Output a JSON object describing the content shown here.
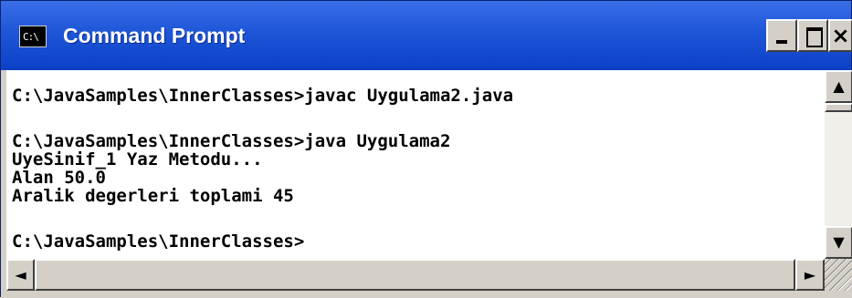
{
  "window": {
    "title": "Command Prompt",
    "icon_label": "C:\\",
    "icon": "console-icon",
    "controls": {
      "minimize": "minimize-icon",
      "maximize": "maximize-icon",
      "close": "×"
    }
  },
  "console": {
    "lines": [
      "",
      "C:\\JavaSamples\\InnerClasses>javac Uygulama2.java",
      "",
      "C:\\JavaSamples\\InnerClasses>java Uygulama2",
      "UyeSinif_1 Yaz Metodu...",
      "Alan 50.0",
      "Aralik degerleri toplami 45",
      "",
      "C:\\JavaSamples\\InnerClasses>"
    ]
  },
  "scrollbars": {
    "up": "▲",
    "down": "▼",
    "left": "◄",
    "right": "►"
  },
  "colors": {
    "titlebar": "#1e56d8",
    "console_bg": "#ffffff",
    "text": "#000000"
  }
}
